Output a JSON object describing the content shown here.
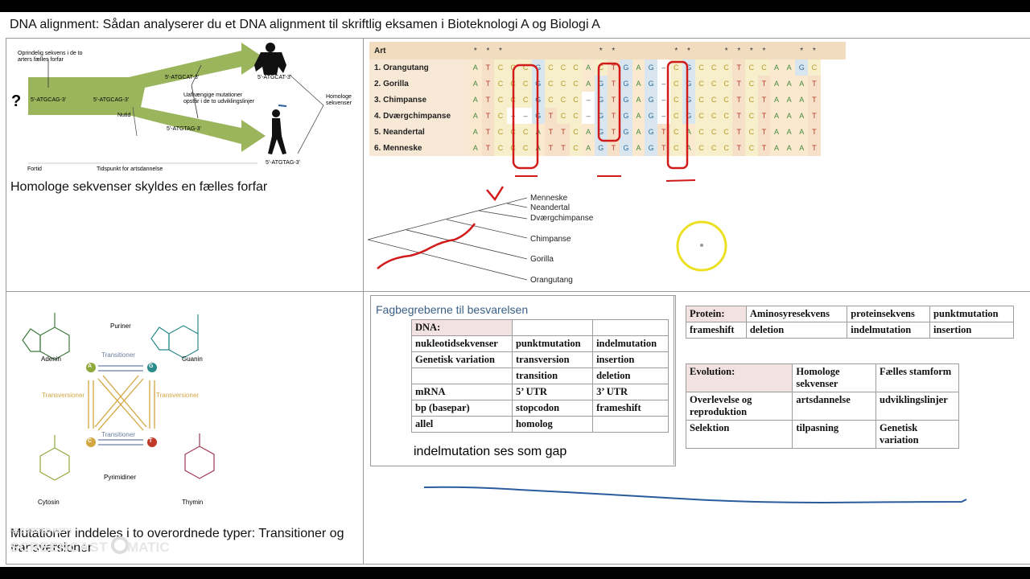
{
  "title": "DNA alignment: Sådan analyserer du et DNA alignment til skriftlig eksamen i Bioteknologi A og Biologi A",
  "panel1": {
    "caption": "Homologe sekvenser skyldes en fælles forfar",
    "question_mark": "?",
    "origin_label": "Oprindelig sekvens i de to arters fælles forfar",
    "seq_left": "5'-ATGCAG-3'",
    "seq_mid": "5'-ATGCAG-3'",
    "seq_top": "5'-ATGCAT-3'",
    "seq_bottom": "5'-ATGTAG-3'",
    "seq_ape": "5'-ATGCAT-3'",
    "seq_human": "5'-ATGTAG-3'",
    "mutation_label": "Uafhængige mutationer opstår i de to udviklingslinjer",
    "homolog_label": "Homologe sekvenser",
    "nutid": "Nutid",
    "fortid": "Fortid",
    "tidspunkt": "Tidspunkt for artsdannelse"
  },
  "alignment": {
    "header": "Art",
    "stars": [
      "*",
      "*",
      "*",
      "",
      "",
      "",
      "",
      "",
      "",
      "",
      "*",
      "*",
      "",
      "",
      "",
      "",
      "*",
      "*",
      "",
      "",
      "*",
      "*",
      "*",
      "*",
      "",
      "",
      "*",
      "*",
      "",
      ""
    ],
    "rows": [
      {
        "name": "1. Orangutang",
        "seq": [
          "A",
          "T",
          "C",
          "C",
          "C",
          "G",
          "C",
          "C",
          "C",
          "A",
          "C",
          "T",
          "G",
          "A",
          "G",
          "–",
          "C",
          "G",
          "C",
          "C",
          "C",
          "T",
          "C",
          "C",
          "A",
          "A",
          "G",
          "C"
        ]
      },
      {
        "name": "2. Gorilla",
        "seq": [
          "A",
          "T",
          "C",
          "C",
          "C",
          "G",
          "C",
          "C",
          "C",
          "A",
          "G",
          "T",
          "G",
          "A",
          "G",
          "–",
          "C",
          "G",
          "C",
          "C",
          "C",
          "T",
          "C",
          "T",
          "A",
          "A",
          "A",
          "T"
        ]
      },
      {
        "name": "3. Chimpanse",
        "seq": [
          "A",
          "T",
          "C",
          "C",
          "C",
          "G",
          "C",
          "C",
          "C",
          "–",
          "G",
          "T",
          "G",
          "A",
          "G",
          "–",
          "C",
          "G",
          "C",
          "C",
          "C",
          "T",
          "C",
          "T",
          "A",
          "A",
          "A",
          "T"
        ]
      },
      {
        "name": "4. Dværgchimpanse",
        "seq": [
          "A",
          "T",
          "C",
          "–",
          "–",
          "G",
          "T",
          "C",
          "C",
          "–",
          "G",
          "T",
          "G",
          "A",
          "G",
          "–",
          "C",
          "G",
          "C",
          "C",
          "C",
          "T",
          "C",
          "T",
          "A",
          "A",
          "A",
          "T"
        ]
      },
      {
        "name": "5. Neandertal",
        "seq": [
          "A",
          "T",
          "C",
          "C",
          "C",
          "A",
          "T",
          "T",
          "C",
          "A",
          "G",
          "T",
          "G",
          "A",
          "G",
          "T",
          "C",
          "A",
          "C",
          "C",
          "C",
          "T",
          "C",
          "T",
          "A",
          "A",
          "A",
          "T"
        ]
      },
      {
        "name": "6. Menneske",
        "seq": [
          "A",
          "T",
          "C",
          "C",
          "C",
          "A",
          "T",
          "T",
          "C",
          "A",
          "G",
          "T",
          "G",
          "A",
          "G",
          "T",
          "C",
          "A",
          "C",
          "C",
          "C",
          "T",
          "C",
          "T",
          "A",
          "A",
          "A",
          "T"
        ]
      }
    ]
  },
  "tree": {
    "leaves": [
      "Menneske",
      "Neandertal",
      "Dværgchimpanse",
      "Chimpanse",
      "Gorilla",
      "Orangutang"
    ]
  },
  "panel3": {
    "caption": "Mutationer inddeles i to overordnede typer: Transitioner og transversioner",
    "puriner": "Puriner",
    "pyrimidiner": "Pyrimidiner",
    "adenin": "Adenin",
    "guanin": "Guanin",
    "cytosin": "Cytosin",
    "thymin": "Thymin",
    "transitioner_top": "Transitioner",
    "transitioner_bottom": "Transitioner",
    "transversioner_left": "Transversioner",
    "transversioner_right": "Transversioner",
    "A": "A",
    "G": "G",
    "C": "C",
    "T": "T"
  },
  "panel4": {
    "heading": "Fagbegreberne til besvarelsen",
    "dna_table": [
      [
        "DNA:",
        "",
        ""
      ],
      [
        "nukleotidsekvenser",
        "punktmutation",
        "indelmutation"
      ],
      [
        "Genetisk variation",
        "transversion",
        "insertion"
      ],
      [
        "",
        "transition",
        "deletion"
      ],
      [
        "mRNA",
        "5’ UTR",
        "3’ UTR"
      ],
      [
        "bp (basepar)",
        "stopcodon",
        "frameshift"
      ],
      [
        "allel",
        "homolog",
        ""
      ]
    ],
    "note": "indelmutation ses som gap",
    "protein_table": [
      [
        "Protein:",
        "Aminosyresekvens",
        "proteinsekvens",
        "punktmutation"
      ],
      [
        "frameshift",
        "deletion",
        "indelmutation",
        "insertion"
      ]
    ],
    "evolution_table": [
      [
        "Evolution:",
        "Homologe sekvenser",
        "Fælles stamform"
      ],
      [
        "Overlevelse og reproduktion",
        "artsdannelse",
        "udviklingslinjer"
      ],
      [
        "Selektion",
        "tilpasning",
        "Genetisk variation"
      ]
    ]
  },
  "watermark": {
    "top": "RECORDED WITH",
    "bottom": "SCREENCAST",
    "suffix": "MATIC"
  },
  "colors": {
    "arrow_green": "#9bb55c",
    "annotation_red": "#d11a1a",
    "pen_blue": "#2a5b9e",
    "cursor_yellow": "#ece022"
  }
}
